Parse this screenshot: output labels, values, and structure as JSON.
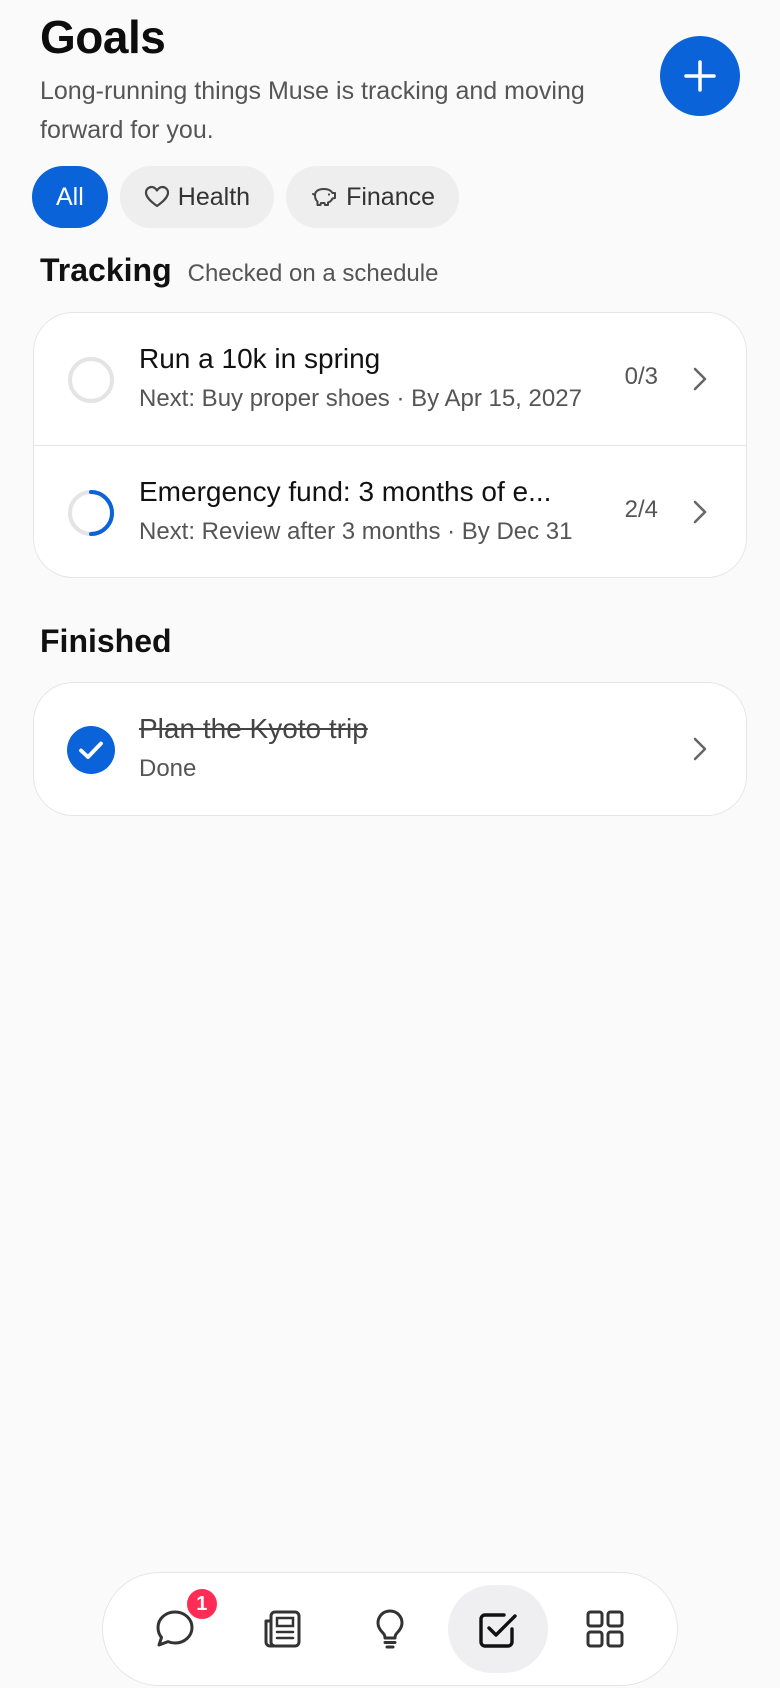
{
  "header": {
    "title": "Goals",
    "subtitle": "Long-running things Muse is tracking and moving forward for you.",
    "add_icon": "plus-icon"
  },
  "filters": [
    {
      "label": "All",
      "active": true,
      "icon": ""
    },
    {
      "label": "Health",
      "active": false,
      "icon": "heart-icon"
    },
    {
      "label": "Finance",
      "active": false,
      "icon": "piggy-bank-icon"
    }
  ],
  "tracking": {
    "title": "Tracking",
    "subtitle": "Checked on a schedule",
    "goals": [
      {
        "title": "Run a 10k in spring",
        "subtitle": "Next: Buy proper shoes · By Apr 15, 2027",
        "count": "0/3",
        "progress": 0.0
      },
      {
        "title": "Emergency fund: 3 months of e...",
        "subtitle": "Next: Review after 3 months · By Dec 31",
        "count": "2/4",
        "progress": 0.5
      }
    ]
  },
  "finished": {
    "title": "Finished",
    "goals": [
      {
        "title": "Plan the Kyoto trip",
        "subtitle": "Done"
      }
    ]
  },
  "nav": {
    "items": [
      {
        "icon": "chat-bubble-icon",
        "badge": "1",
        "active": false
      },
      {
        "icon": "newspaper-icon",
        "active": false
      },
      {
        "icon": "lightbulb-icon",
        "active": false
      },
      {
        "icon": "checkbox-icon",
        "active": true
      },
      {
        "icon": "grid-icon",
        "active": false
      }
    ]
  },
  "colors": {
    "accent": "#0a63d8",
    "badge": "#ff2d55",
    "background": "#fafafa"
  }
}
